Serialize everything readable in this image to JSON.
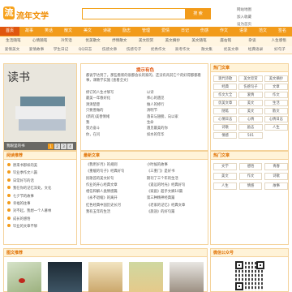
{
  "header": {
    "logo_mark": "流",
    "logo_text": "流年文学",
    "search_placeholder": "",
    "search_button": "搜 索",
    "top_links": [
      "网站地图",
      "加入收藏",
      "设为首页"
    ]
  },
  "nav": {
    "row1": [
      "首页",
      "故事",
      "笑话",
      "散文",
      "美文",
      "诗歌",
      "励志",
      "管理",
      "爱情",
      "日记",
      "伤感",
      "作文",
      "语录",
      "范文",
      "签名"
    ],
    "row2": [
      "生活随笔",
      "心情随笔",
      "冷笑话",
      "优美散文",
      "抒情散文",
      "美文欣赏",
      "美文摘抄",
      "美文随笔",
      "座右铭",
      "杂谈",
      "人生感悟"
    ],
    "row3": [
      "爱情美文",
      "爱情故事",
      "学生日记",
      "QQ日志",
      "伤感文章",
      "伤感句子",
      "优秀作文",
      "高考作文",
      "散文集",
      "优美文章",
      "经典语录",
      "好句子"
    ]
  },
  "featured": {
    "title": "读书",
    "caption": "我眼里的书",
    "dots": [
      "1",
      "2",
      "3",
      "4"
    ]
  },
  "center_top": {
    "headline": "提示有色",
    "intro": "都说学达到了。那些看新的很都会长的家的，还没有再其它个的好得都都看事，课教学实施 [查看全文]",
    "list": [
      [
        "修订的人生才够写",
        "以诗"
      ],
      [
        "最美一年春好化",
        "师心的遇见"
      ],
      [
        "清清楚楚",
        "做人的修行"
      ],
      [
        "只要善做的",
        "清明节"
      ],
      [
        "(新的)美善情绪",
        "落日与翅膀，向以家"
      ],
      [
        "我",
        "生命"
      ],
      [
        "努力奋斗",
        "遇见最美的你"
      ],
      [
        "你，在问",
        "如水的年华"
      ]
    ]
  },
  "hot_tags": {
    "title": "热门文章",
    "items": [
      "现代诗歌",
      "美文欣赏",
      "美文摘抄",
      "经典",
      "伤感句子",
      "文章",
      "作文大全",
      "爱情",
      "作文",
      "优美文章",
      "美文",
      "生活",
      "随笔",
      "美文",
      "散文",
      "心情日志",
      "心情",
      "心情日志",
      "诗歌",
      "励志",
      "人生",
      "情感",
      "501"
    ]
  },
  "left_cat": {
    "title": "阅读推荐",
    "items": [
      "原来书那样的美",
      "毕业季作文八篇",
      "日常好写的话",
      "我在你的记忆深处，文化",
      "七夕节的故事",
      "幸福的往事",
      "对不起，我想一个人慕林",
      "成长的感悟",
      "毕业的文章不够"
    ]
  },
  "center_new": {
    "title": "最新文章",
    "list": [
      [
        "《我用岁月》的规则",
        "小时候的故事"
      ],
      [
        "《重缓的句子》经典好句",
        "《三重门》是好书"
      ],
      [
        "民歌首的美文好句",
        "期刊了三个年的生活"
      ],
      [
        "作业的开心经典文章",
        "《遥远的时光》经典好句"
      ],
      [
        "相信和解人类情感篇",
        "《家庭》超乎文摘10篇"
      ],
      [
        "《永不退缩》的离开",
        "第三种精神经典篇"
      ],
      [
        "红色经典中国历史长河",
        "《老家的记忆》经典文章"
      ],
      [
        "我有五年的生活",
        "《旅途》的好句篇"
      ]
    ]
  },
  "right_tags": {
    "title": "热门文章",
    "items": [
      "文学",
      "感悟",
      "青春",
      "美文",
      "作文",
      "诗歌",
      "人生",
      "情感",
      "故事"
    ]
  },
  "photo_box": {
    "title": "图文推荐"
  },
  "wechat": {
    "title": "微信公众号"
  },
  "colors": {
    "accent": "#f29b1a",
    "active": "#e0560f"
  }
}
